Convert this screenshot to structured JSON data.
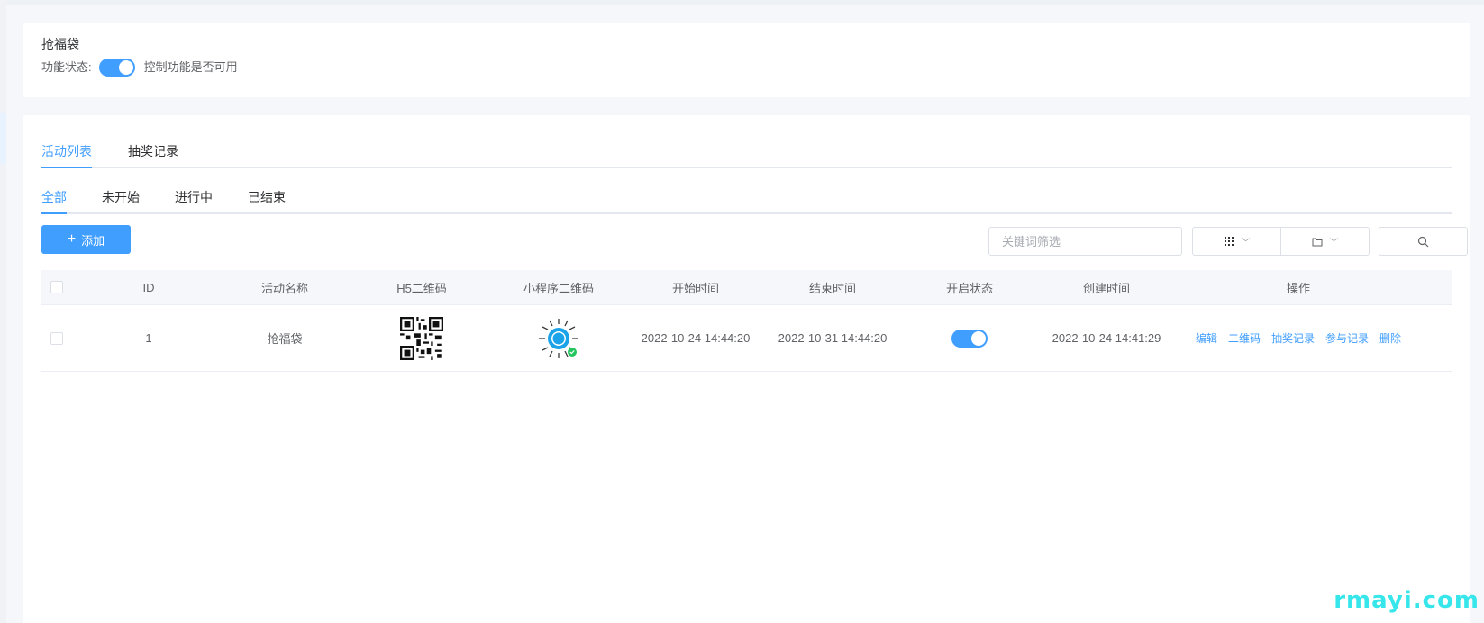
{
  "feature": {
    "title": "抢福袋",
    "status_label": "功能状态:",
    "enabled": true,
    "hint": "控制功能是否可用"
  },
  "tabs": [
    {
      "label": "活动列表",
      "active": true
    },
    {
      "label": "抽奖记录",
      "active": false
    }
  ],
  "subtabs": [
    {
      "label": "全部",
      "active": true
    },
    {
      "label": "未开始",
      "active": false
    },
    {
      "label": "进行中",
      "active": false
    },
    {
      "label": "已结束",
      "active": false
    }
  ],
  "toolbar": {
    "add_label": "添加",
    "search_placeholder": "关键词筛选"
  },
  "table": {
    "headers": [
      "ID",
      "活动名称",
      "H5二维码",
      "小程序二维码",
      "开始时间",
      "结束时间",
      "开启状态",
      "创建时间",
      "操作"
    ],
    "rows": [
      {
        "id": "1",
        "name": "抢福袋",
        "start": "2022-10-24 14:44:20",
        "end": "2022-10-31 14:44:20",
        "enabled": true,
        "created": "2022-10-24 14:41:29",
        "actions": [
          "编辑",
          "二维码",
          "抽奖记录",
          "参与记录",
          "删除"
        ]
      }
    ]
  },
  "watermark": "rmayi.com",
  "colors": {
    "primary": "#409eff",
    "border": "#e4e7ed",
    "text": "#303133",
    "muted": "#606266",
    "watermark": "#37e6ea"
  }
}
